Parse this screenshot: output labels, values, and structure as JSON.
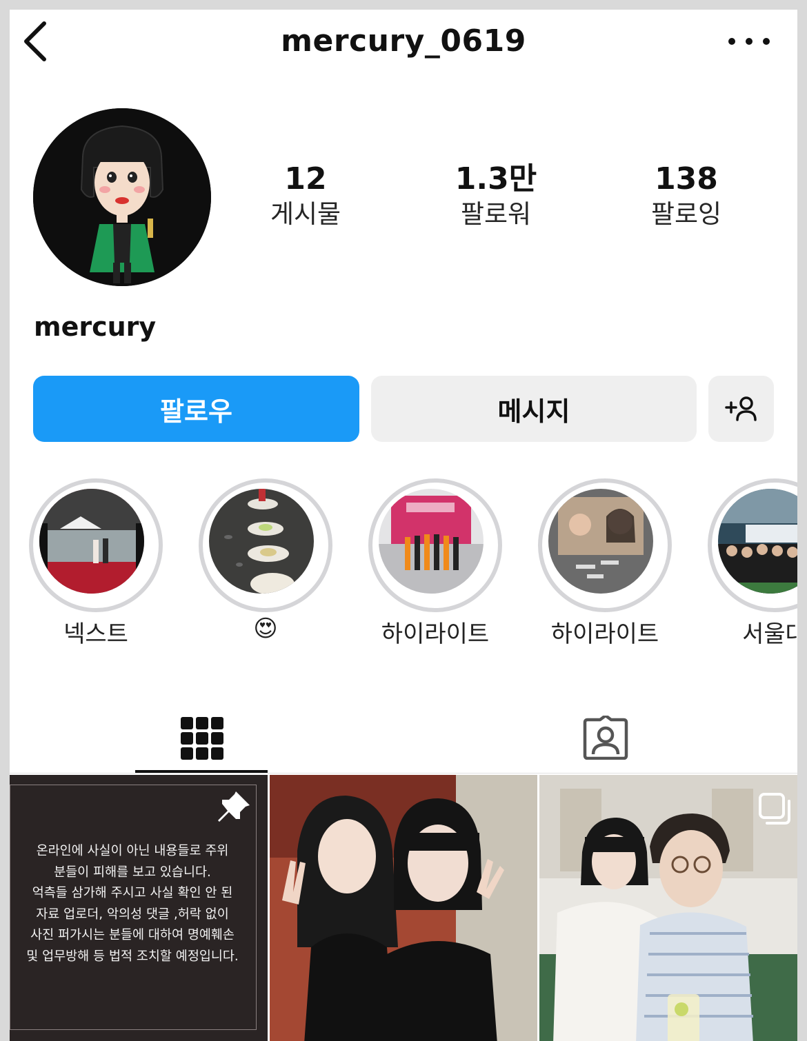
{
  "header": {
    "username": "mercury_0619",
    "back_icon": "chevron-left-icon",
    "more_icon": "more-horizontal-icon"
  },
  "profile": {
    "display_name": "mercury"
  },
  "stats": [
    {
      "value": "12",
      "label": "게시물"
    },
    {
      "value": "1.3만",
      "label": "팔로워"
    },
    {
      "value": "138",
      "label": "팔로잉"
    }
  ],
  "actions": {
    "follow_label": "팔로우",
    "message_label": "메시지",
    "add_user_icon": "add-person-icon"
  },
  "highlights": [
    {
      "label": "넥스트"
    },
    {
      "label": "😍"
    },
    {
      "label": "하이라이트"
    },
    {
      "label": "하이라이트"
    },
    {
      "label": "서울대"
    }
  ],
  "tabs": {
    "grid_icon": "grid-icon",
    "tagged_icon": "tagged-person-icon",
    "active": "grid"
  },
  "posts": {
    "notice_text": "온라인에 사실이 아닌 내용들로 주위\n분들이 피해를 보고 있습니다.\n억측들 삼가해 주시고 사실 확인 안 된\n자료 업로더, 악의성 댓글 ,허락 없이\n사진 퍼가시는 분들에 대하여 명예훼손\n및 업무방해 등 법적 조치할 예정입니다.",
    "notice_icon": "pin-icon",
    "post3_icon": "multiple-photos-icon"
  },
  "colors": {
    "accent": "#1a9af7",
    "button_gray": "#efefef",
    "ring_gray": "#d5d5d8"
  }
}
